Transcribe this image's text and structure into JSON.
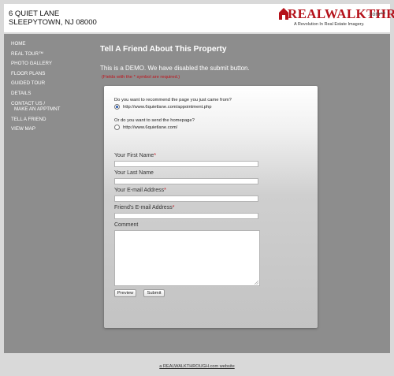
{
  "header": {
    "address_line1": "6 QUIET LANE",
    "address_line2": "SLEEPYTOWN, NJ 08000",
    "logo_main": "REALWALKTHRU",
    "logo_com": ".com™",
    "logo_tagline": "A Revolution In Real Estate Imagery."
  },
  "nav": {
    "items": [
      {
        "label": "HOME"
      },
      {
        "label": "REAL TOUR™"
      },
      {
        "label": "PHOTO GALLERY"
      },
      {
        "label": "FLOOR PLANS"
      },
      {
        "label": "GUIDED TOUR"
      },
      {
        "label": "DETAILS"
      },
      {
        "label": "CONTACT US /",
        "sub": "MAKE AN APPTMNT"
      },
      {
        "label": "TELL A FRIEND"
      },
      {
        "label": "VIEW MAP"
      }
    ]
  },
  "content": {
    "title": "Tell A Friend About This Property",
    "demo_notice": "This is a DEMO. We have disabled the submit button.",
    "required_note": "(Fields with the * symbol are required.)"
  },
  "form": {
    "q1": "Do you want to recommend the page you just came from?",
    "option1": "http://www.6quietlane.com/appointment.php",
    "q2": "Or do you want to send the homepage?",
    "option2": "http://www.6quietlane.com/",
    "first_name_label": "Your First Name",
    "last_name_label": "Your Last Name",
    "email_label": "Your E-mail Address",
    "friend_email_label": "Friend's E-mail Address",
    "comment_label": "Comment",
    "required_mark": "*",
    "preview_button": "Preview",
    "submit_button": "Submit",
    "selected_option": 1
  },
  "footer": {
    "link_text": "a REALWALKTHROUGH.com website"
  },
  "colors": {
    "brand_red": "#b5121b",
    "stage_gray": "#8d8d8d",
    "required_red": "#c0121b"
  }
}
